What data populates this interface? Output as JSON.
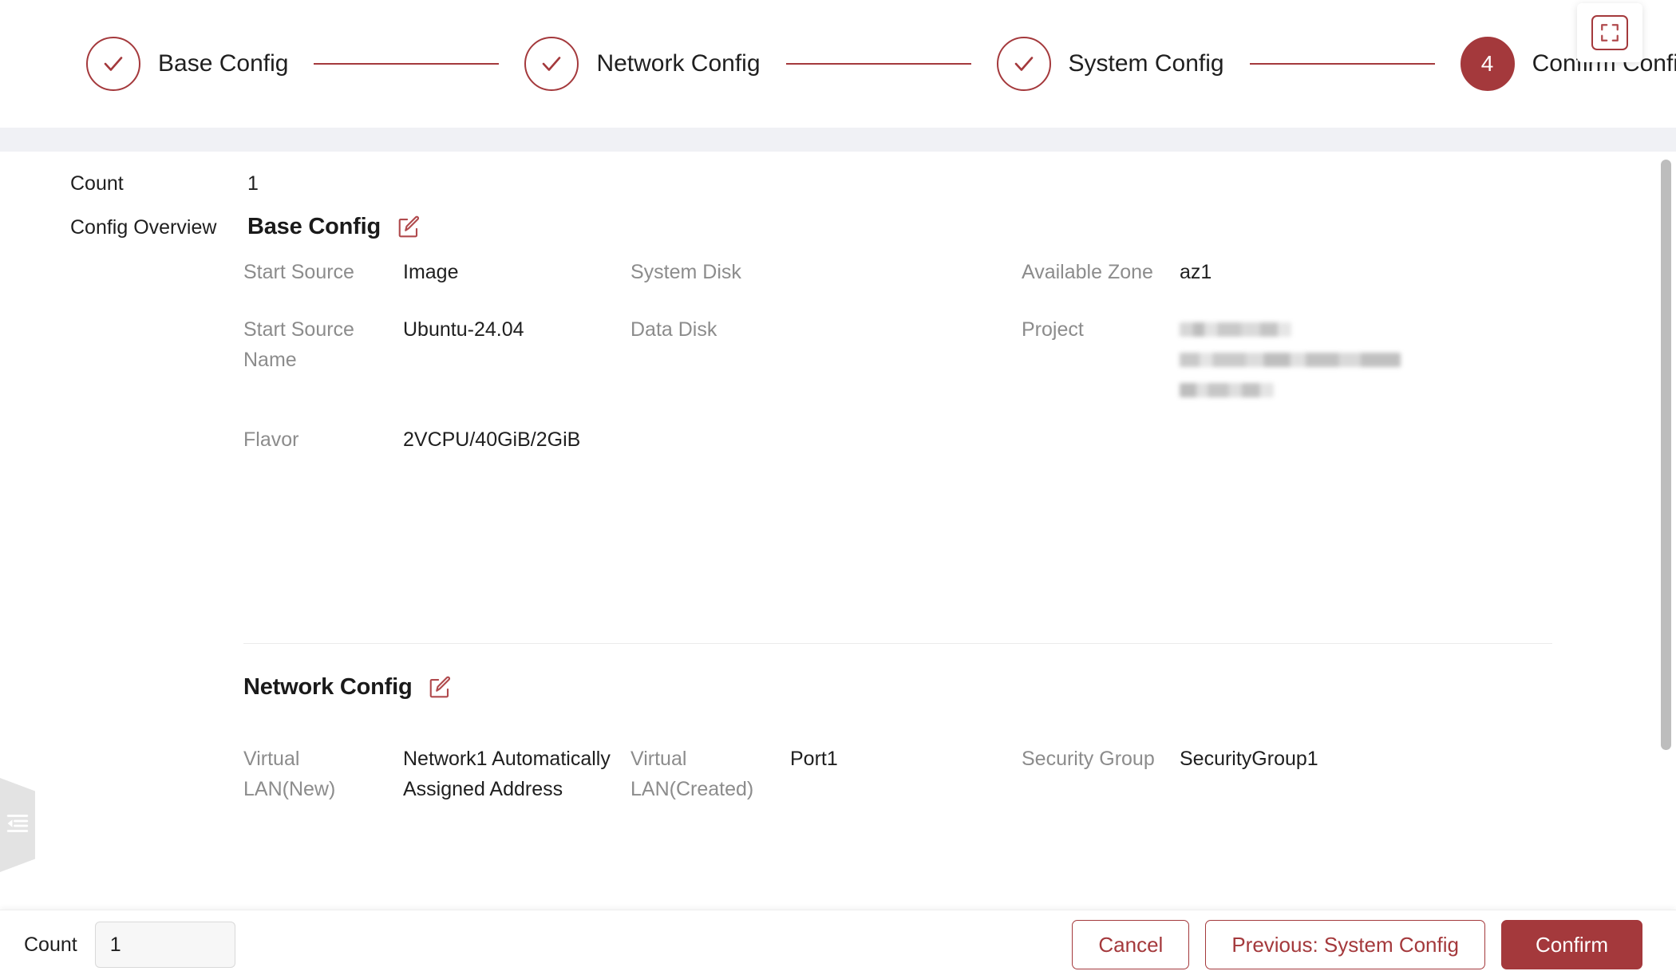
{
  "theme": {
    "accent": "#a4393c",
    "label_gray": "#8c8c8c",
    "text": "#1f1f1f",
    "band": "#f0f1f5"
  },
  "stepper": {
    "steps": [
      {
        "label": "Base Config",
        "state": "done",
        "marker": "check-icon"
      },
      {
        "label": "Network Config",
        "state": "done",
        "marker": "check-icon"
      },
      {
        "label": "System Config",
        "state": "done",
        "marker": "check-icon"
      },
      {
        "label": "Confirm Config",
        "state": "active",
        "marker": "4"
      }
    ]
  },
  "overlay": {
    "fullscreen_icon": "fullscreen-icon",
    "collapse_icon": "menu-fold-icon"
  },
  "main": {
    "count": {
      "label": "Count",
      "value": "1"
    },
    "config_overview": {
      "label": "Config Overview"
    },
    "sections": [
      {
        "title": "Base Config",
        "edit_icon": "edit-icon",
        "fields": [
          {
            "label": "Start Source",
            "value": "Image"
          },
          {
            "label": "System Disk",
            "value": ""
          },
          {
            "label": "Available Zone",
            "value": "az1"
          },
          {
            "label": "Start Source Name",
            "value": "Ubuntu-24.04"
          },
          {
            "label": "Data Disk",
            "value": ""
          },
          {
            "label": "Project",
            "value": "",
            "redacted": true
          },
          {
            "label": "Flavor",
            "value": "2VCPU/40GiB/2GiB"
          },
          {
            "label": "",
            "value": ""
          },
          {
            "label": "",
            "value": ""
          }
        ]
      },
      {
        "title": "Network Config",
        "edit_icon": "edit-icon",
        "fields": [
          {
            "label": "Virtual LAN(New)",
            "value": "Network1 Automatically Assigned Address"
          },
          {
            "label": "Virtual LAN(Created)",
            "value": "Port1"
          },
          {
            "label": "Security Group",
            "value": "SecurityGroup1"
          }
        ]
      }
    ]
  },
  "footer": {
    "count_label": "Count",
    "count_value": "1",
    "count_placeholder": "1",
    "buttons": {
      "cancel": "Cancel",
      "previous": "Previous: System Config",
      "confirm": "Confirm"
    }
  }
}
